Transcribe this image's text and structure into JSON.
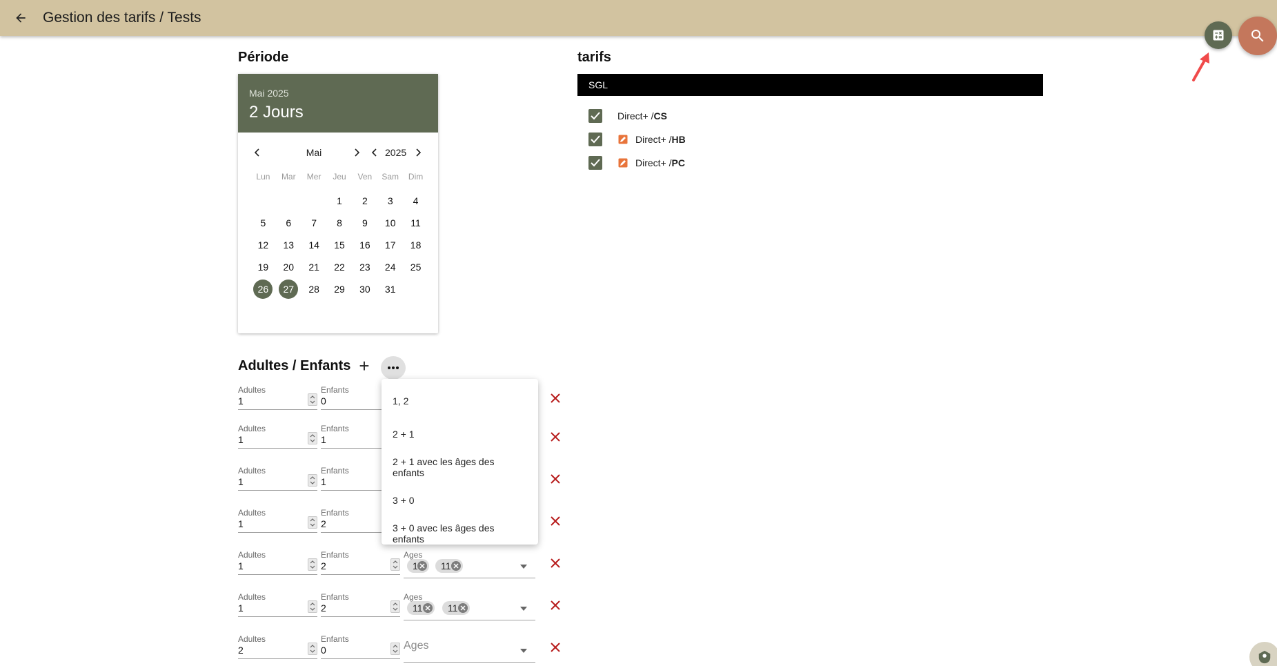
{
  "header": {
    "title": "Gestion des tarifs / Tests"
  },
  "icons": {
    "back": "arrow-left-icon",
    "calc": "calculator-icon",
    "search": "search-icon"
  },
  "colors": {
    "header": "#d2c3a0",
    "primary": "#5f6a53",
    "search_fab": "#c4775c",
    "delete": "#b71c1c",
    "edit_icon": "#e8743b"
  },
  "periode": {
    "title": "Période",
    "header_month_year": "Mai 2025",
    "header_days": "2 Jours",
    "nav_month": "Mai",
    "nav_year": "2025",
    "weekdays": [
      "Lun",
      "Mar",
      "Mer",
      "Jeu",
      "Ven",
      "Sam",
      "Dim"
    ],
    "selected": [
      "26",
      "27"
    ]
  },
  "tarifs": {
    "title": "tarifs",
    "group": "SGL",
    "rows": [
      {
        "prefix": "Direct+ / ",
        "code": "CS",
        "edit": false
      },
      {
        "prefix": "Direct+ / ",
        "code": "HB",
        "edit": true
      },
      {
        "prefix": "Direct+ / ",
        "code": "PC",
        "edit": true
      }
    ]
  },
  "occupancy": {
    "title": "Adultes / Enfants",
    "label_adults": "Adultes",
    "label_children": "Enfants",
    "label_ages": "Ages",
    "rows": [
      {
        "adults": "1",
        "children": "0",
        "ages": null
      },
      {
        "adults": "1",
        "children": "1",
        "ages": null
      },
      {
        "adults": "1",
        "children": "1",
        "ages": null
      },
      {
        "adults": "1",
        "children": "2",
        "ages": null
      },
      {
        "adults": "1",
        "children": "2",
        "ages": [
          "1",
          "11"
        ]
      },
      {
        "adults": "1",
        "children": "2",
        "ages": [
          "11",
          "11"
        ]
      },
      {
        "adults": "2",
        "children": "0",
        "ages": []
      }
    ]
  },
  "menu": {
    "items": [
      "1, 2",
      "2 + 1",
      "2 + 1 avec les âges des enfants",
      "3 + 0",
      "3 + 0 avec les âges des enfants"
    ]
  }
}
